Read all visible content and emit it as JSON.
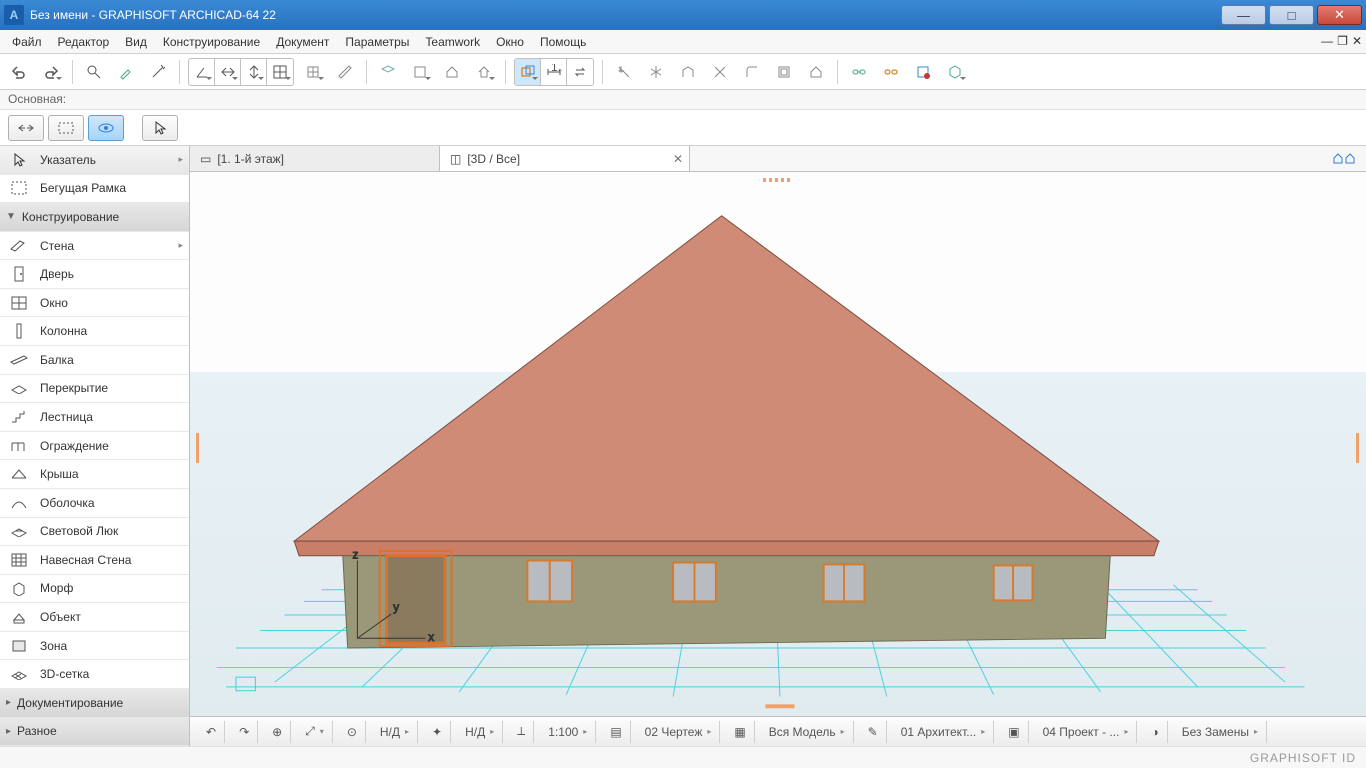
{
  "titlebar": {
    "title": "Без имени - GRAPHISOFT ARCHICAD-64 22"
  },
  "menu": {
    "items": [
      "Файл",
      "Редактор",
      "Вид",
      "Конструирование",
      "Документ",
      "Параметры",
      "Teamwork",
      "Окно",
      "Помощь"
    ]
  },
  "strip2": {
    "label": "Основная:"
  },
  "tabs": {
    "t1": "[1. 1-й этаж]",
    "t2": "[3D / Все]"
  },
  "sidebar": {
    "pointer": "Указатель",
    "marquee": "Бегущая Рамка",
    "hdr_design": "Конструирование",
    "wall": "Стена",
    "door": "Дверь",
    "window": "Окно",
    "column": "Колонна",
    "beam": "Балка",
    "slab": "Перекрытие",
    "stair": "Лестница",
    "railing": "Ограждение",
    "roof": "Крыша",
    "shell": "Оболочка",
    "skylight": "Световой Люк",
    "curtain": "Навесная Стена",
    "morph": "Морф",
    "object": "Объект",
    "zone": "Зона",
    "mesh": "3D-сетка",
    "hdr_doc": "Документирование",
    "hdr_misc": "Разное"
  },
  "status": {
    "nd1": "Н/Д",
    "nd2": "Н/Д",
    "scale": "1:100",
    "s1": "02 Чертеж",
    "s2": "Вся Модель",
    "s3": "01 Архитект...",
    "s4": "04 Проект - ...",
    "s5": "Без Замены"
  },
  "footer": {
    "brand": "GRAPHISOFT ID"
  }
}
